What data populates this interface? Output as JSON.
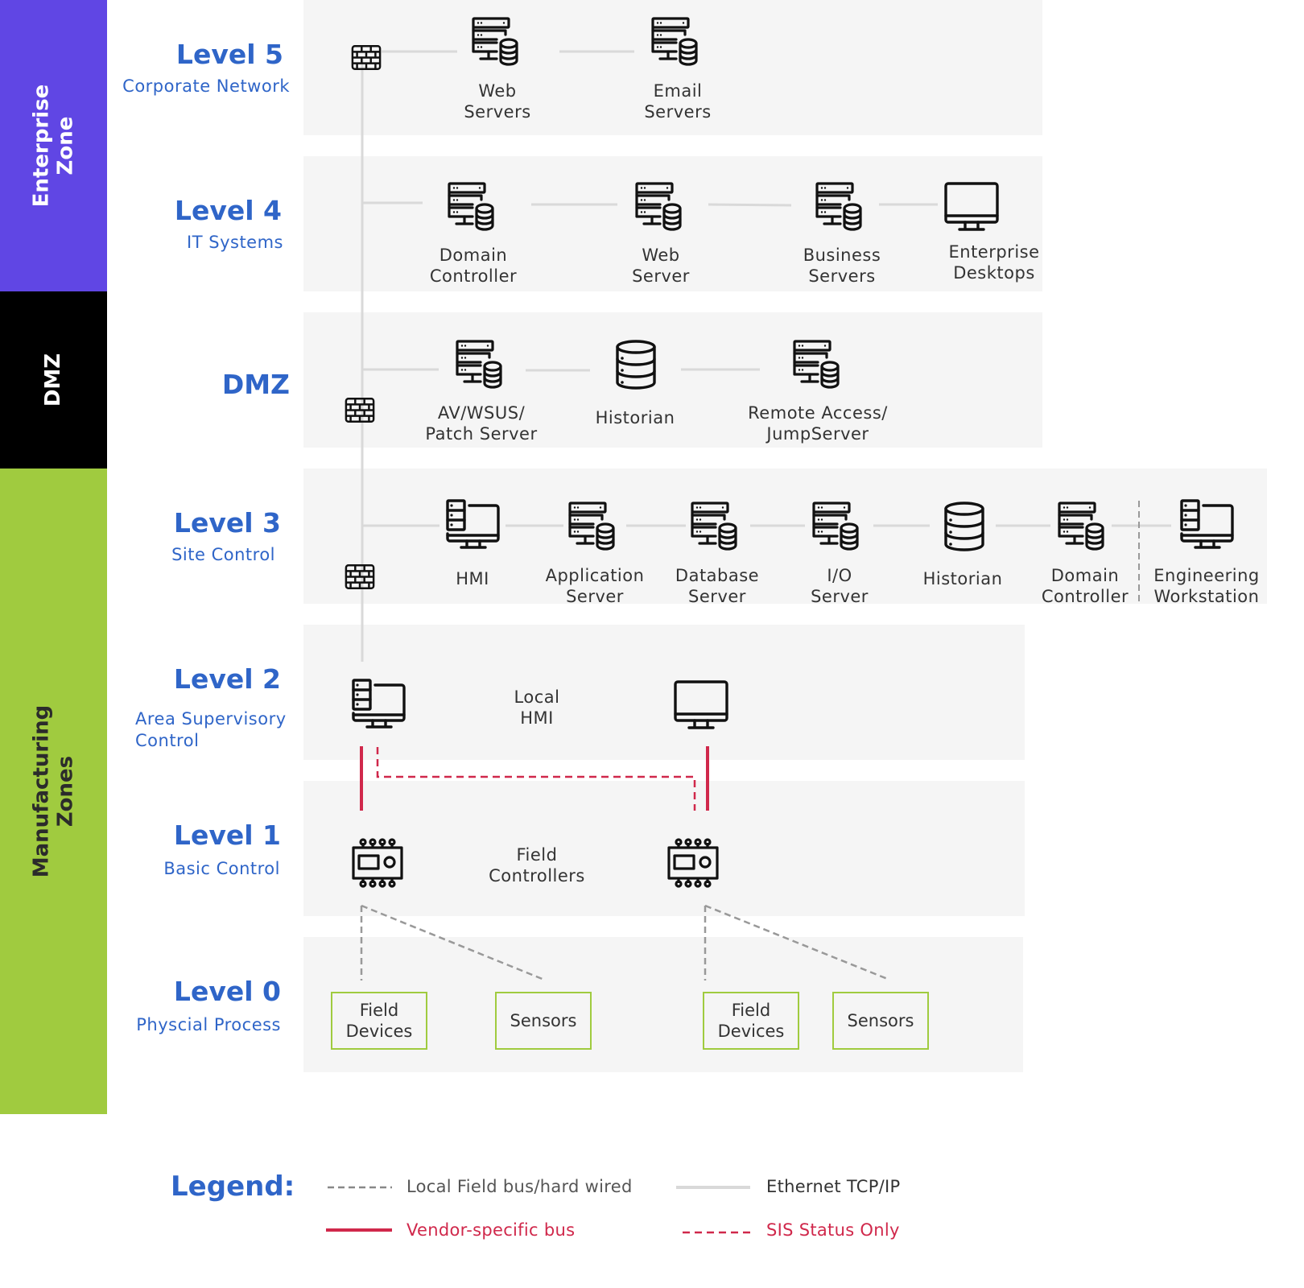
{
  "zones": [
    {
      "label": "Enterprise\nZone",
      "color": "#6046e4",
      "text_color": "#ffffff"
    },
    {
      "label": "DMZ",
      "color": "#000000",
      "text_color": "#ffffff"
    },
    {
      "label": "Manufacturing\nZones",
      "color": "#a0cb3f",
      "text_color": "#2b2b2b"
    }
  ],
  "levels": [
    {
      "title": "Level 5",
      "subtitle": "Corporate Network"
    },
    {
      "title": "Level 4",
      "subtitle": "IT Systems"
    },
    {
      "title": "DMZ",
      "subtitle": ""
    },
    {
      "title": "Level 3",
      "subtitle": "Site Control"
    },
    {
      "title": "Level 2",
      "subtitle": "Area Supervisory\nControl"
    },
    {
      "title": "Level 1",
      "subtitle": "Basic Control"
    },
    {
      "title": "Level 0",
      "subtitle": "Physcial Process"
    }
  ],
  "nodes": {
    "level5": [
      {
        "label": "Web\nServers",
        "icon": "server-database-icon"
      },
      {
        "label": "Email\nServers",
        "icon": "server-database-icon"
      }
    ],
    "level4": [
      {
        "label": "Domain\nController",
        "icon": "server-database-icon"
      },
      {
        "label": "Web\nServer",
        "icon": "server-database-icon"
      },
      {
        "label": "Business\nServers",
        "icon": "server-database-icon"
      },
      {
        "label": "Enterprise\nDesktops",
        "icon": "monitor-icon"
      }
    ],
    "dmz": [
      {
        "label": "AV/WSUS/\nPatch Server",
        "icon": "server-database-icon"
      },
      {
        "label": "Historian",
        "icon": "database-icon"
      },
      {
        "label": "Remote Access/\nJumpServer",
        "icon": "server-database-icon"
      }
    ],
    "level3": [
      {
        "label": "HMI",
        "icon": "workstation-icon"
      },
      {
        "label": "Application\nServer",
        "icon": "server-database-icon"
      },
      {
        "label": "Database\nServer",
        "icon": "server-database-icon"
      },
      {
        "label": "I/O\nServer",
        "icon": "server-database-icon"
      },
      {
        "label": "Historian",
        "icon": "database-icon"
      },
      {
        "label": "Domain\nController",
        "icon": "server-database-icon"
      },
      {
        "label": "Engineering\nWorkstation",
        "icon": "workstation-icon"
      }
    ],
    "level2": {
      "label": "Local\nHMI"
    },
    "level1": {
      "label": "Field\nControllers"
    },
    "level0": [
      {
        "label": "Field\nDevices"
      },
      {
        "label": "Sensors"
      },
      {
        "label": "Field\nDevices"
      },
      {
        "label": "Sensors"
      }
    ]
  },
  "legend": {
    "title": "Legend:",
    "items": [
      {
        "label": "Local Field bus/hard wired",
        "style": "dashed-gray",
        "color": "#888888"
      },
      {
        "label": "Ethernet TCP/IP",
        "style": "solid-gray",
        "color": "#d9d9d9"
      },
      {
        "label": "Vendor-specific bus",
        "style": "solid-red",
        "color": "#d0284b"
      },
      {
        "label": "SIS Status Only",
        "style": "dashed-red",
        "color": "#d0284b"
      }
    ]
  },
  "colors": {
    "accent_blue": "#2f65c8",
    "band_bg": "#f5f5f5",
    "ethernet": "#d9d9d9",
    "vendor_bus": "#d0284b",
    "field_bus": "#888888",
    "level0_box": "#a0cb3f"
  }
}
